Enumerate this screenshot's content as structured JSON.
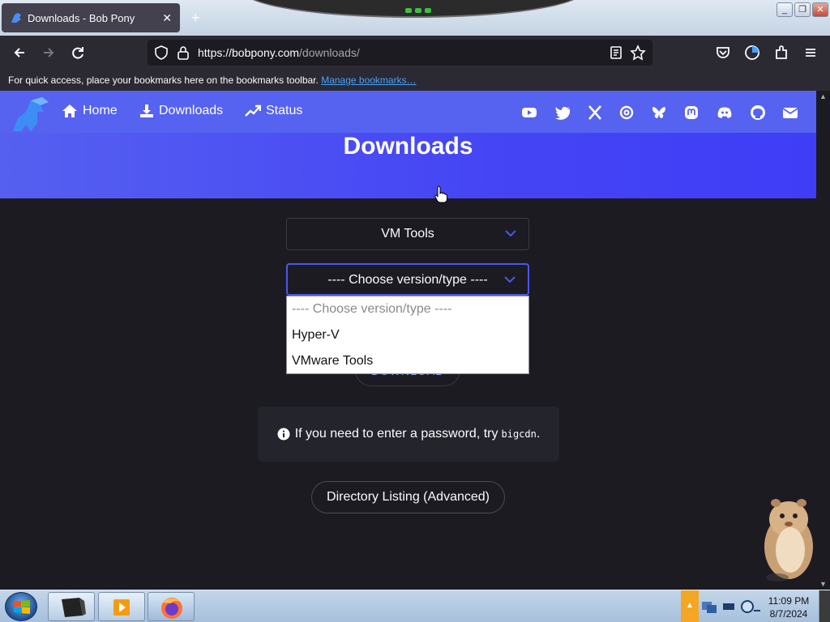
{
  "browser": {
    "tab_title": "Downloads - Bob Pony",
    "url_host": "https://bobpony.com",
    "url_path": "/downloads/",
    "bookmarks_text": "For quick access, place your bookmarks here on the bookmarks toolbar.",
    "bookmarks_link": "Manage bookmarks…"
  },
  "site_nav": {
    "items": [
      {
        "label": "Home",
        "icon": "home-icon"
      },
      {
        "label": "Downloads",
        "icon": "download-icon"
      },
      {
        "label": "Status",
        "icon": "trend-icon"
      }
    ],
    "social": [
      "youtube-icon",
      "twitter-icon",
      "x-icon",
      "threads-icon",
      "bluesky-icon",
      "mastodon-icon",
      "discord-icon",
      "github-icon",
      "mail-icon"
    ]
  },
  "hero": {
    "title": "Downloads"
  },
  "form": {
    "category_value": "VM Tools",
    "version_value": "---- Choose version/type ----",
    "dropdown_options": [
      "---- Choose version/type ----",
      "Hyper-V",
      "VMware Tools"
    ],
    "download_button": "DOWNLOAD"
  },
  "notice": {
    "text": "If you need to enter a password, try",
    "code": "bigcdn",
    "suffix": "."
  },
  "listing_button": "Directory Listing (Advanced)",
  "taskbar": {
    "time": "11:09 PM",
    "date": "8/7/2024"
  },
  "colors": {
    "hero_start": "#5560f0",
    "hero_end": "#3f3df6",
    "link": "#45a1ff",
    "page_bg": "#1c1b22"
  }
}
